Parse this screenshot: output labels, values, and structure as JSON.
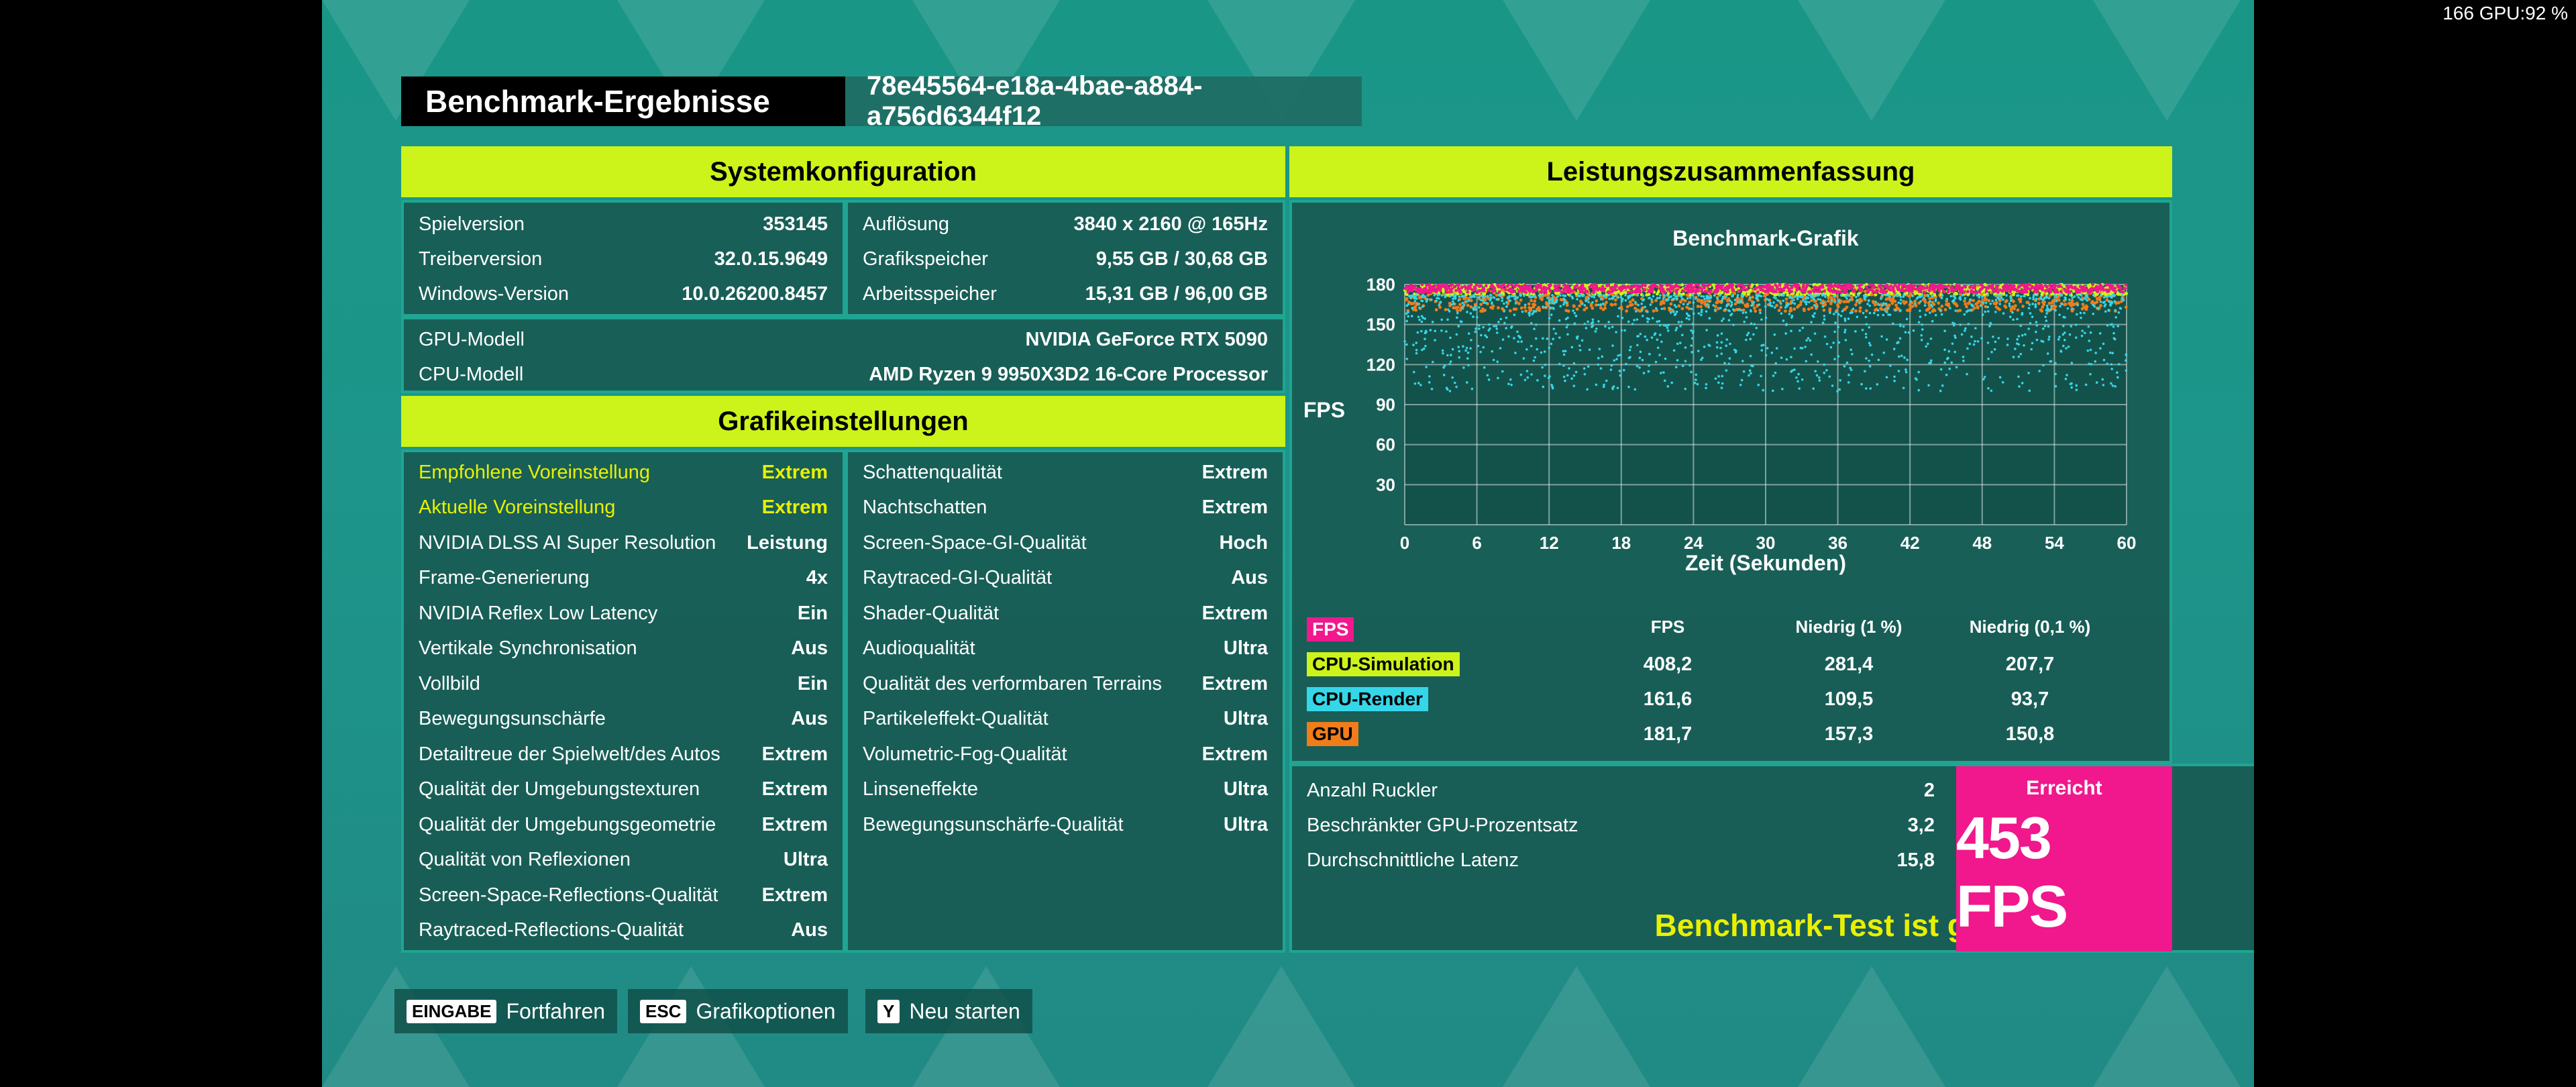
{
  "overlay": {
    "text": "166 GPU:92 %"
  },
  "header": {
    "title": "Benchmark-Ergebnisse",
    "uuid": "78e45564-e18a-4bae-a884-a756d6344f12"
  },
  "system": {
    "title": "Systemkonfiguration",
    "left": [
      {
        "label": "Spielversion",
        "value": "353145"
      },
      {
        "label": "Treiberversion",
        "value": "32.0.15.9649"
      },
      {
        "label": "Windows-Version",
        "value": "10.0.26200.8457"
      }
    ],
    "right": [
      {
        "label": "Auflösung",
        "value": "3840 x 2160 @ 165Hz"
      },
      {
        "label": "Grafikspeicher",
        "value": "9,55 GB / 30,68 GB"
      },
      {
        "label": "Arbeitsspeicher",
        "value": "15,31 GB / 96,00 GB"
      }
    ],
    "wide": [
      {
        "label": "GPU-Modell",
        "value": "NVIDIA GeForce RTX 5090"
      },
      {
        "label": "CPU-Modell",
        "value": "AMD Ryzen 9 9950X3D2 16-Core Processor"
      }
    ]
  },
  "graphics": {
    "title": "Grafikeinstellungen",
    "left": [
      {
        "label": "Empfohlene Voreinstellung",
        "value": "Extrem"
      },
      {
        "label": "Aktuelle Voreinstellung",
        "value": "Extrem"
      },
      {
        "label": "NVIDIA DLSS AI Super Resolution",
        "value": "Leistung"
      },
      {
        "label": "Frame-Generierung",
        "value": "4x"
      },
      {
        "label": "NVIDIA Reflex Low Latency",
        "value": "Ein"
      },
      {
        "label": "Vertikale Synchronisation",
        "value": "Aus"
      },
      {
        "label": "Vollbild",
        "value": "Ein"
      },
      {
        "label": "Bewegungsunschärfe",
        "value": "Aus"
      },
      {
        "label": "Detailtreue der Spielwelt/des Autos",
        "value": "Extrem"
      },
      {
        "label": "Qualität der Umgebungstexturen",
        "value": "Extrem"
      },
      {
        "label": "Qualität der Umgebungsgeometrie",
        "value": "Extrem"
      },
      {
        "label": "Qualität von Reflexionen",
        "value": "Ultra"
      },
      {
        "label": "Screen-Space-Reflections-Qualität",
        "value": "Extrem"
      },
      {
        "label": "Raytraced-Reflections-Qualität",
        "value": "Aus"
      }
    ],
    "right": [
      {
        "label": "Schattenqualität",
        "value": "Extrem"
      },
      {
        "label": "Nachtschatten",
        "value": "Extrem"
      },
      {
        "label": "Screen-Space-GI-Qualität",
        "value": "Hoch"
      },
      {
        "label": "Raytraced-GI-Qualität",
        "value": "Aus"
      },
      {
        "label": "Shader-Qualität",
        "value": "Extrem"
      },
      {
        "label": "Audioqualität",
        "value": "Ultra"
      },
      {
        "label": "Qualität des verformbaren Terrains",
        "value": "Extrem"
      },
      {
        "label": "Partikeleffekt-Qualität",
        "value": "Ultra"
      },
      {
        "label": "Volumetric-Fog-Qualität",
        "value": "Extrem"
      },
      {
        "label": "Linseneffekte",
        "value": "Ultra"
      },
      {
        "label": "Bewegungsunschärfe-Qualität",
        "value": "Ultra"
      }
    ]
  },
  "summary": {
    "title": "Leistungszusammenfassung",
    "columns": [
      "FPS",
      "Niedrig (1 %)",
      "Niedrig (0,1 %)"
    ],
    "rows": [
      {
        "name": "FPS",
        "color": "#f0188c",
        "values": [
          "",
          "",
          ""
        ]
      },
      {
        "name": "CPU-Simulation",
        "color": "#ccf31a",
        "values": [
          "408,2",
          "281,4",
          "207,7"
        ]
      },
      {
        "name": "CPU-Render",
        "color": "#35d6e8",
        "values": [
          "161,6",
          "109,5",
          "93,7"
        ]
      },
      {
        "name": "GPU",
        "color": "#f07c1a",
        "values": [
          "181,7",
          "157,3",
          "150,8"
        ]
      }
    ],
    "stats": [
      {
        "label": "Anzahl Ruckler",
        "value": "2"
      },
      {
        "label": "Beschränkter GPU-Prozentsatz",
        "value": "3,2"
      },
      {
        "label": "Durchschnittliche Latenz",
        "value": "15,8"
      }
    ],
    "valid_text": "Benchmark-Test ist gültig",
    "achieved_label": "Erreicht",
    "achieved_value": "453 FPS",
    "achieved_color": "#f0188c"
  },
  "chart_data": {
    "type": "scatter",
    "title": "Benchmark-Grafik",
    "xlabel": "Zeit (Sekunden)",
    "ylabel": "FPS",
    "xlim": [
      0,
      60
    ],
    "ylim": [
      0,
      180
    ],
    "xticks": [
      "0",
      "6",
      "12",
      "18",
      "24",
      "30",
      "36",
      "42",
      "48",
      "54",
      "60"
    ],
    "yticks": [
      "30",
      "60",
      "90",
      "120",
      "150",
      "180"
    ],
    "grid": true,
    "series": [
      {
        "name": "GPU",
        "color": "#f07c1a",
        "band": [
          160,
          178
        ]
      },
      {
        "name": "CPU-Simulation",
        "color": "#ccf31a",
        "band": [
          172,
          180
        ]
      },
      {
        "name": "FPS",
        "color": "#f0188c",
        "band": [
          174,
          180
        ]
      },
      {
        "name": "CPU-Render",
        "color": "#35d6e8",
        "band": [
          100,
          172
        ]
      }
    ]
  },
  "footer": {
    "buttons": [
      {
        "key": "EINGABE",
        "label": "Fortfahren"
      },
      {
        "key": "ESC",
        "label": "Grafikoptionen"
      },
      {
        "key": "Y",
        "label": "Neu starten"
      }
    ]
  }
}
